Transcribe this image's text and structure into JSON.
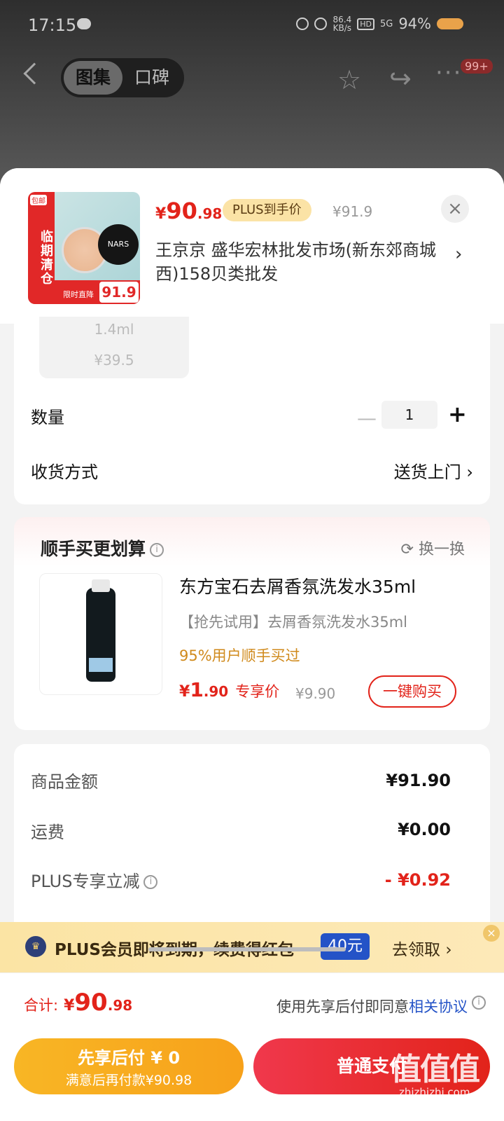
{
  "status_bar": {
    "time": "17:15",
    "net_speed": "86.4",
    "net_unit": "KB/s",
    "hd": "HD",
    "signal": "5G",
    "battery": "94%"
  },
  "nav": {
    "tabs": [
      "图集",
      "口碑"
    ],
    "active_tab": 0,
    "badge": "99+"
  },
  "product": {
    "price_symbol": "¥",
    "price_int": "90",
    "price_dec": ".98",
    "plus_tag": "PLUS到手价",
    "orig_price": "¥91.9",
    "store": "王京京  盛华宏林批发市场(新东郊商城西)158贝类批发",
    "thumb": {
      "free_ship": "包邮",
      "ribbon": "临期清仓",
      "brand": "NARS",
      "tag_price": "91.9",
      "tag_label": "限时直降"
    }
  },
  "spec": {
    "size": "1.4ml",
    "price": "¥39.5"
  },
  "quantity": {
    "label": "数量",
    "value": "1"
  },
  "delivery": {
    "label": "收货方式",
    "value": "送货上门"
  },
  "addon": {
    "title": "顺手买更划算",
    "refresh": "换一换",
    "name": "东方宝石去屑香氛洗发水35ml",
    "sub": "【抢先试用】去屑香氛洗发水35ml",
    "stat": "95%用户顺手买过",
    "price_symbol": "¥",
    "price_int": "1",
    "price_dec": ".90",
    "price_label": "专享价",
    "orig": "¥9.90",
    "buy": "一键购买"
  },
  "summary": [
    {
      "label": "商品金额",
      "value": "¥91.90"
    },
    {
      "label": "运费",
      "value": "¥0.00"
    },
    {
      "label": "PLUS专享立减",
      "value": "- ¥0.92"
    }
  ],
  "plus_banner": {
    "text": "PLUS会员即将到期，续费得红包",
    "amount": "40元",
    "action": "去领取"
  },
  "total": {
    "label": "合计:",
    "symbol": "¥",
    "int": "90",
    "dec": ".98"
  },
  "agreement": {
    "text": "使用先享后付即同意",
    "link": "相关协议"
  },
  "buttons": {
    "defer_title": "先享后付 ¥ 0",
    "defer_sub": "满意后再付款¥90.98",
    "pay": "普通支付"
  },
  "watermark": {
    "main": "值值值",
    "sub": "zhizhizhi.com"
  },
  "colors": {
    "accent_red": "#e2231a",
    "plus_gold": "#fbe3a6",
    "defer_orange": "#f7a11a",
    "link_blue": "#2453c7"
  }
}
